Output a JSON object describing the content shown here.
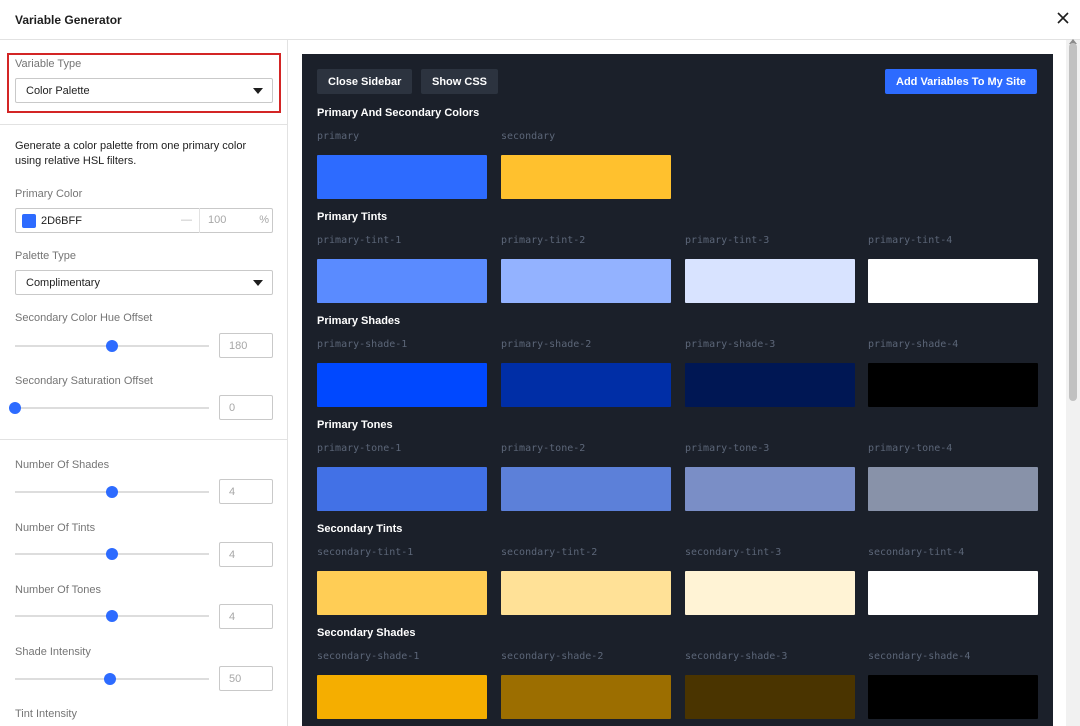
{
  "modal": {
    "title": "Variable Generator"
  },
  "sidebar": {
    "variable_type": {
      "label": "Variable Type",
      "value": "Color Palette"
    },
    "description": "Generate a color palette from one primary color using relative HSL filters.",
    "primary_color": {
      "label": "Primary Color",
      "hex": "2D6BFF",
      "swatch": "#2d6bff",
      "dash": "—",
      "opacity": "100",
      "opacity_unit": "%"
    },
    "palette_type": {
      "label": "Palette Type",
      "value": "Complimentary"
    },
    "sliders": [
      {
        "label": "Secondary Color Hue Offset",
        "value": "180",
        "fraction": 0.5
      },
      {
        "label": "Secondary Saturation Offset",
        "value": "0",
        "fraction": 0.0
      },
      {
        "label": "Number Of Shades",
        "value": "4",
        "fraction": 0.5
      },
      {
        "label": "Number Of Tints",
        "value": "4",
        "fraction": 0.5
      },
      {
        "label": "Number Of Tones",
        "value": "4",
        "fraction": 0.5
      },
      {
        "label": "Shade Intensity",
        "value": "50",
        "fraction": 0.49
      }
    ],
    "tint_intensity_label": "Tint Intensity"
  },
  "toolbar": {
    "close_sidebar": "Close Sidebar",
    "show_css": "Show CSS",
    "add_variables": "Add Variables To My Site"
  },
  "groups": [
    {
      "title": "Primary And Secondary Colors",
      "swatches": [
        {
          "name": "primary",
          "color": "#2d6bff"
        },
        {
          "name": "secondary",
          "color": "#ffc12e"
        }
      ]
    },
    {
      "title": "Primary Tints",
      "swatches": [
        {
          "name": "primary-tint-1",
          "color": "#5a8bff"
        },
        {
          "name": "primary-tint-2",
          "color": "#93b2ff"
        },
        {
          "name": "primary-tint-3",
          "color": "#d8e3ff"
        },
        {
          "name": "primary-tint-4",
          "color": "#ffffff"
        }
      ]
    },
    {
      "title": "Primary Shades",
      "swatches": [
        {
          "name": "primary-shade-1",
          "color": "#0048ff"
        },
        {
          "name": "primary-shade-2",
          "color": "#002ea6"
        },
        {
          "name": "primary-shade-3",
          "color": "#001754"
        },
        {
          "name": "primary-shade-4",
          "color": "#000000"
        }
      ]
    },
    {
      "title": "Primary Tones",
      "swatches": [
        {
          "name": "primary-tone-1",
          "color": "#4271e6"
        },
        {
          "name": "primary-tone-2",
          "color": "#5c80d9"
        },
        {
          "name": "primary-tone-3",
          "color": "#7a8ec6"
        },
        {
          "name": "primary-tone-4",
          "color": "#8892a9"
        }
      ]
    },
    {
      "title": "Secondary Tints",
      "swatches": [
        {
          "name": "secondary-tint-1",
          "color": "#ffcd55"
        },
        {
          "name": "secondary-tint-2",
          "color": "#ffe197"
        },
        {
          "name": "secondary-tint-3",
          "color": "#fff3d5"
        },
        {
          "name": "secondary-tint-4",
          "color": "#ffffff"
        }
      ]
    },
    {
      "title": "Secondary Shades",
      "swatches": [
        {
          "name": "secondary-shade-1",
          "color": "#f5ae00"
        },
        {
          "name": "secondary-shade-2",
          "color": "#9c6e00"
        },
        {
          "name": "secondary-shade-3",
          "color": "#4a3400"
        },
        {
          "name": "secondary-shade-4",
          "color": "#000000"
        }
      ]
    }
  ],
  "icons": {
    "close": "close-icon",
    "caret": "chevron-down-icon"
  }
}
